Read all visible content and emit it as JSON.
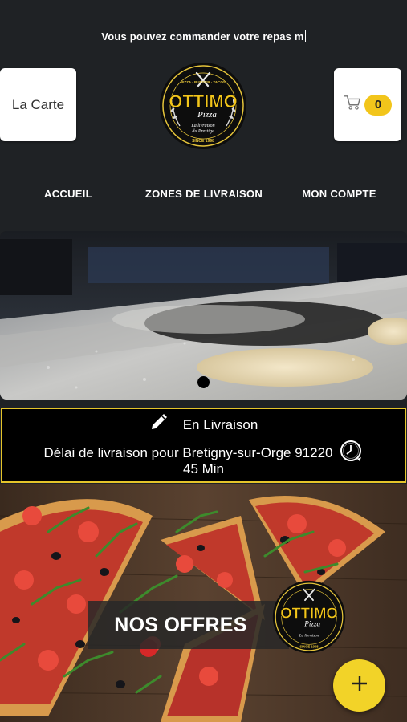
{
  "header": {
    "ticker_text": "Vous pouvez commander votre repas m",
    "carte_label": "La Carte",
    "cart_count": "0",
    "logo": {
      "brand": "OTTIMO",
      "sub": "Pizza",
      "top_text": "PIZZA · BURGER · TACOS",
      "tagline": "La livraison du Prestige",
      "since": "SINCE 1998"
    }
  },
  "nav": {
    "items": [
      {
        "label": "ACCUEIL"
      },
      {
        "label": "ZONES DE LIVRAISON"
      },
      {
        "label": "MON COMPTE"
      }
    ]
  },
  "delivery": {
    "mode": "En Livraison",
    "delay_text": "Délai de livraison pour Bretigny-sur-Orge 91220",
    "time": "45 Min"
  },
  "offers": {
    "title": "NOS OFFRES"
  },
  "colors": {
    "background": "#1f2225",
    "accent": "#f2c51b",
    "delivery_border": "#e4c42a"
  },
  "icons": {
    "cart": "cart-icon",
    "pencil": "pencil-icon",
    "clock": "clock-icon",
    "plus": "plus-icon"
  }
}
